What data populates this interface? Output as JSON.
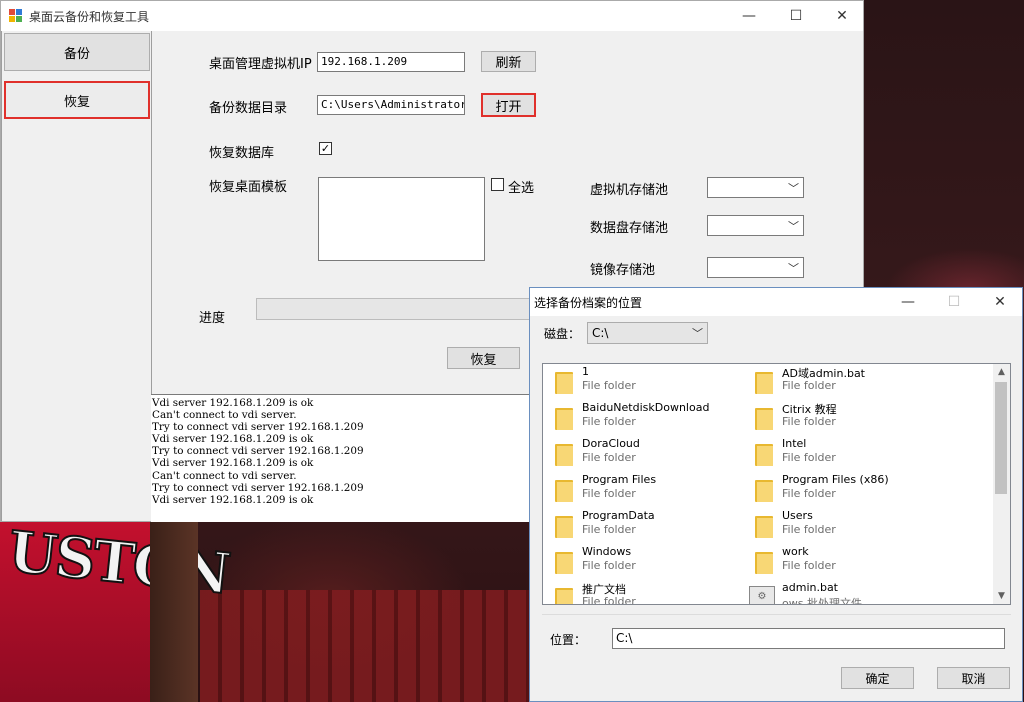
{
  "main_window": {
    "title": "桌面云备份和恢复工具",
    "controls": {
      "minimize": "—",
      "maximize": "☐",
      "close": "✕"
    }
  },
  "sidebar": {
    "items": [
      {
        "label": "备份",
        "active": false
      },
      {
        "label": "恢复",
        "active": true
      }
    ]
  },
  "form": {
    "ip_label": "桌面管理虚拟机IP",
    "ip_value": "192.168.1.209",
    "refresh_label": "刷新",
    "dir_label": "备份数据目录",
    "dir_value": "C:\\Users\\Administrator",
    "open_label": "打开",
    "restore_db_label": "恢复数据库",
    "restore_db_checked": "✓",
    "restore_template_label": "恢复桌面模板",
    "select_all_label": "全选",
    "vm_pool_label": "虚拟机存储池",
    "disk_pool_label": "数据盘存储池",
    "image_pool_label": "镜像存储池",
    "progress_label": "进度",
    "restore_button": "恢复"
  },
  "log": {
    "lines": [
      "Vdi server 192.168.1.209 is ok",
      "Can't connect to vdi server.",
      "Try to connect vdi server 192.168.1.209",
      "Vdi server 192.168.1.209 is ok",
      "Try to connect vdi server 192.168.1.209",
      "Vdi server 192.168.1.209 is ok",
      "Can't connect to vdi server.",
      "Try to connect vdi server 192.168.1.209",
      "Vdi server 192.168.1.209 is ok"
    ]
  },
  "dialog": {
    "title": "选择备份档案的位置",
    "disk_label": "磁盘：",
    "disk_value": "C:\\",
    "files": [
      {
        "name": "1",
        "type": "File folder",
        "icon": "folder-icon"
      },
      {
        "name": "AD域admin.bat",
        "type": "File folder",
        "icon": "folder-icon"
      },
      {
        "name": "BaiduNetdiskDownload",
        "type": "File folder",
        "icon": "folder-icon"
      },
      {
        "name": "Citrix 教程",
        "type": "File folder",
        "icon": "folder-icon"
      },
      {
        "name": "DoraCloud",
        "type": "File folder",
        "icon": "folder-icon"
      },
      {
        "name": "Intel",
        "type": "File folder",
        "icon": "folder-icon"
      },
      {
        "name": "Program Files",
        "type": "File folder",
        "icon": "folder-icon"
      },
      {
        "name": "Program Files (x86)",
        "type": "File folder",
        "icon": "folder-icon"
      },
      {
        "name": "ProgramData",
        "type": "File folder",
        "icon": "folder-icon"
      },
      {
        "name": "Users",
        "type": "File folder",
        "icon": "folder-icon"
      },
      {
        "name": "Windows",
        "type": "File folder",
        "icon": "folder-icon"
      },
      {
        "name": "work",
        "type": "File folder",
        "icon": "folder-icon"
      },
      {
        "name": "推广文档",
        "type": "File folder",
        "icon": "folder-icon"
      },
      {
        "name": "admin.bat",
        "type": "ows 批处理文件",
        "icon": "batch-file-icon"
      }
    ],
    "location_label": "位置：",
    "location_value": "C:\\",
    "ok_label": "确定",
    "cancel_label": "取消"
  },
  "colors": {
    "highlight_border": "#e0302b",
    "window_bg": "#f0f0f0",
    "folder_yellow": "#f8d775"
  }
}
